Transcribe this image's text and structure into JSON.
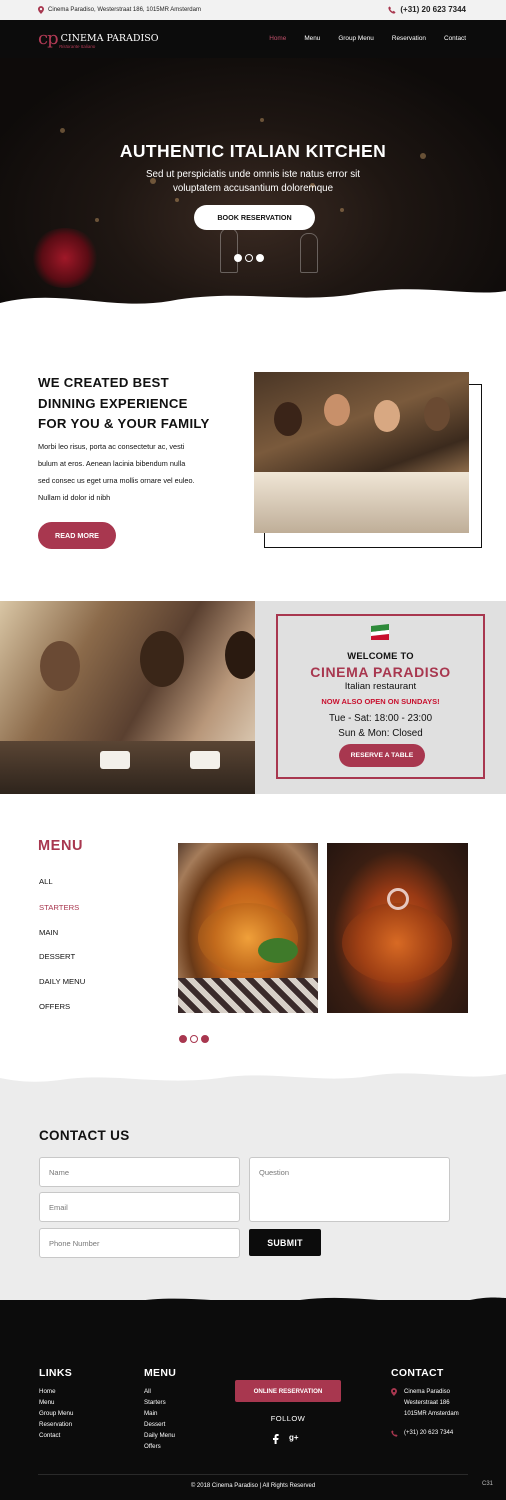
{
  "topbar": {
    "address": "Cinema Paradiso, Westerstraat 186, 1015MR Amsterdam",
    "phone": "(+31) 20 623 7344"
  },
  "brand": {
    "mark": "cp",
    "name": "CINEMA PARADISO",
    "tagline": "Ristorante Italiano"
  },
  "nav": {
    "items": [
      {
        "label": "Home",
        "active": true
      },
      {
        "label": "Menu"
      },
      {
        "label": "Group Menu"
      },
      {
        "label": "Reservation"
      },
      {
        "label": "Contact"
      }
    ]
  },
  "hero": {
    "title": "AUTHENTIC ITALIAN KITCHEN",
    "subtitle_line1": "Sed ut perspiciatis unde omnis iste natus error sit",
    "subtitle_line2": "voluptatem accusantium doloremque",
    "button": "BOOK RESERVATION",
    "slides": 3,
    "active_slide": 1
  },
  "about": {
    "title_line1": "WE CREATED BEST",
    "title_line2": "DINNING EXPERIENCE",
    "title_line3": "FOR YOU & YOUR FAMILY",
    "text_line1": "Morbi leo risus, porta ac consectetur ac, vesti",
    "text_line2": "bulum at eros. Aenean lacinia bibendum nulla",
    "text_line3": "sed consec us eget urna mollis ornare vel euleo.",
    "text_line4": "Nullam id dolor id nibh",
    "button": "READ MORE"
  },
  "welcome": {
    "line1": "WELCOME TO",
    "name": "CINEMA PARADISO",
    "type": "Italian restaurant",
    "notice": "NOW ALSO OPEN ON SUNDAYS!",
    "hours1": "Tue - Sat: 18:00 - 23:00",
    "hours2": "Sun & Mon: Closed",
    "button": "RESERVE A TABLE"
  },
  "menu": {
    "title": "MENU",
    "categories": [
      {
        "label": "ALL"
      },
      {
        "label": "STARTERS",
        "active": true
      },
      {
        "label": "MAIN"
      },
      {
        "label": "DESSERT"
      },
      {
        "label": "DAILY MENU"
      },
      {
        "label": "OFFERS"
      }
    ]
  },
  "contact": {
    "title": "CONTACT US",
    "name_placeholder": "Name",
    "email_placeholder": "Email",
    "phone_placeholder": "Phone Number",
    "question_placeholder": "Question",
    "submit": "SUBMIT"
  },
  "footer": {
    "links_title": "LINKS",
    "links": [
      "Home",
      "Menu",
      "Group Menu",
      "Reservation",
      "Contact"
    ],
    "menu_title": "MENU",
    "menu_links": [
      "All",
      "Starters",
      "Main",
      "Dessert",
      "Daily Menu",
      "Offers"
    ],
    "online_button": "ONLINE RESERVATION",
    "follow": "FOLLOW",
    "contact_title": "CONTACT",
    "contact_name": "Cinema Paradiso",
    "contact_street": "Westerstraat 186",
    "contact_city": "1015MR Amsterdam",
    "contact_phone": "(+31) 20 623 7344",
    "copyright": "© 2018  Cinema Paradiso  | All Rights Reserved",
    "tag": "C31"
  },
  "colors": {
    "accent": "#a8374f",
    "dark": "#0c0c0c",
    "light_bg": "#ececec"
  },
  "icons": [
    "location-pin-icon",
    "phone-icon",
    "italian-flag-icon",
    "facebook-icon",
    "google-plus-icon"
  ]
}
